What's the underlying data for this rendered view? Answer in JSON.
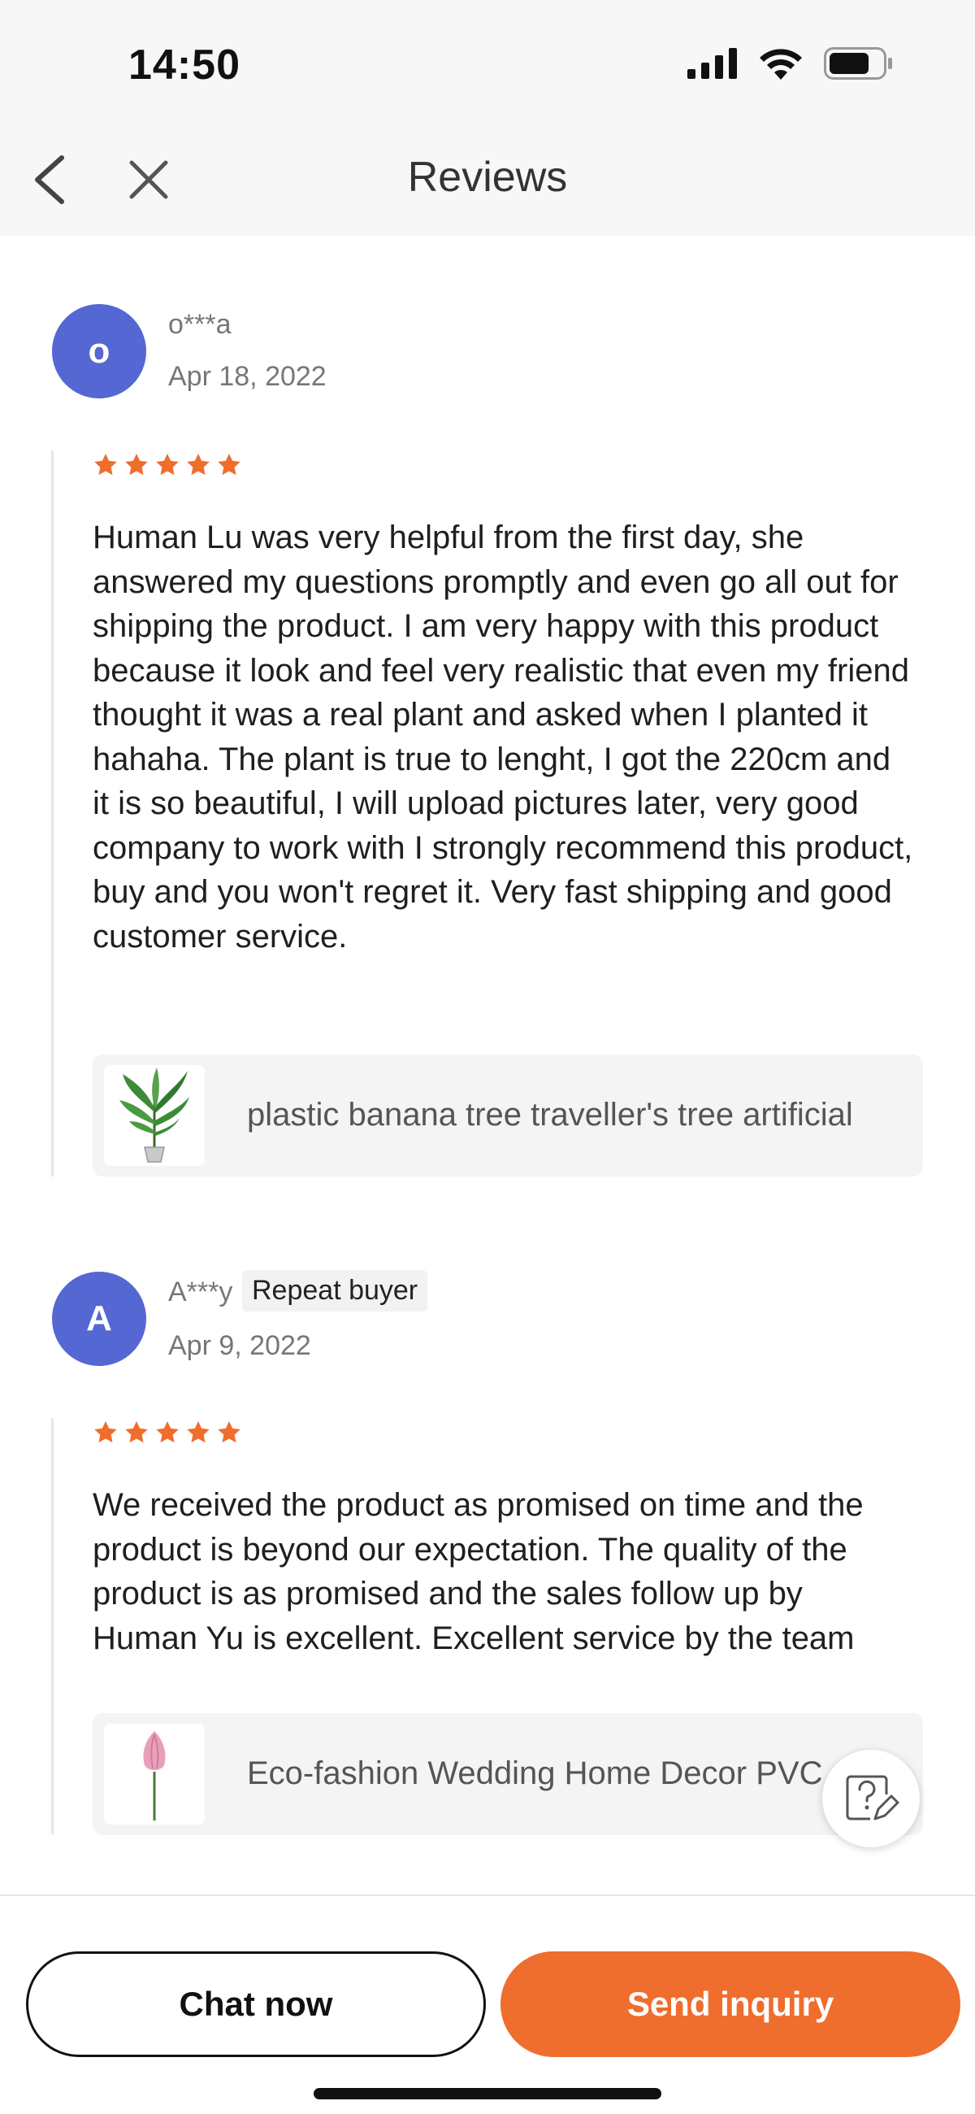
{
  "status_bar": {
    "time": "14:50"
  },
  "header": {
    "title": "Reviews"
  },
  "colors": {
    "accent": "#ef6d2d",
    "avatar": "#5467d3",
    "star": "#ef6d2d"
  },
  "reviews": [
    {
      "avatar_letter": "o",
      "username": "o***a",
      "date": "Apr 18, 2022",
      "rating": 5,
      "text": "Human Lu  was very helpful from the first day, she answered my questions promptly and even go all out for shipping the product. I am very happy with this product because it look and feel very realistic that even my friend thought it was a real plant and asked when I planted it hahaha. The plant is true to lenght, I got the 220cm and it is so beautiful, I will upload pictures later, very good company to work with I strongly recommend this product, buy and you won't regret it. Very fast shipping and good customer service.",
      "product_title": "plastic banana tree traveller's tree artificial",
      "product_icon": "banana-tree-plant"
    },
    {
      "avatar_letter": "A",
      "username": "A***y",
      "badge": "Repeat buyer",
      "date": "Apr 9, 2022",
      "rating": 5,
      "text": "We received the product as promised on time and the product is beyond our expectation. The quality of the product is as promised and the sales follow up by Human Yu is excellent. Excellent service by the team",
      "product_title": "Eco-fashion Wedding Home Decor PVC",
      "product_icon": "lotus-flower"
    }
  ],
  "bottom_bar": {
    "chat_label": "Chat now",
    "inquiry_label": "Send inquiry"
  }
}
